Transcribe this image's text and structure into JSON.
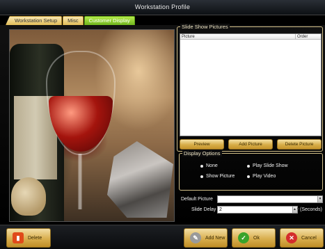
{
  "window": {
    "title": "Workstation Profile"
  },
  "tabs": [
    {
      "label": "Workstation Setup"
    },
    {
      "label": "Misc"
    },
    {
      "label": "Customer Display"
    }
  ],
  "slideshow": {
    "legend": "Slide Show Pictures",
    "columns": {
      "picture": "Picture",
      "order": "Order"
    },
    "buttons": {
      "preview": "Preview",
      "add": "Add Picture",
      "delete": "Delete Picture"
    }
  },
  "display_options": {
    "legend": "Display Options",
    "options": [
      {
        "label": "None"
      },
      {
        "label": "Play Slide Show"
      },
      {
        "label": "Show Picture"
      },
      {
        "label": "Play Video"
      }
    ]
  },
  "fields": {
    "default_picture_label": "Default Picture",
    "default_picture_value": "",
    "slide_delay_label": "Slide Delay",
    "slide_delay_value": "2",
    "slide_delay_unit": "(Seconds)"
  },
  "bottom": {
    "delete": "Delete",
    "add_new": "Add New",
    "ok": "Ok",
    "cancel": "Cancel"
  },
  "colors": {
    "accent_gold": "#d7ad48",
    "active_tab_green": "#8fcf2c",
    "title_bg": "#1a1d22"
  }
}
